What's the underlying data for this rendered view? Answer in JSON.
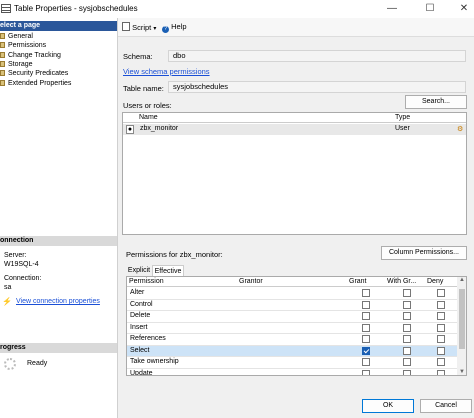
{
  "window": {
    "title": "Table Properties - sysjobschedules",
    "minimize": "—",
    "maximize": "☐",
    "close": "✕"
  },
  "left": {
    "select_page_header": "elect a page",
    "pages": [
      "General",
      "Permissions",
      "Change Tracking",
      "Storage",
      "Security Predicates",
      "Extended Properties"
    ],
    "connection_header": "onnection",
    "server_label": "Server:",
    "server_value": "W19SQL-4",
    "connection_label": "Connection:",
    "connection_value": "sa",
    "view_connection": "View connection properties",
    "progress_header": "rogress",
    "progress_status": "Ready"
  },
  "toolbar": {
    "script_label": "Script",
    "help_label": "Help"
  },
  "main": {
    "schema_label": "Schema:",
    "schema_value": "dbo",
    "view_schema_link": "View schema permissions",
    "table_name_label": "Table name:",
    "table_name_value": "sysjobschedules",
    "users_roles_label": "Users or roles:",
    "search_button": "Search...",
    "users_grid": {
      "headers": [
        "Name",
        "Type"
      ],
      "rows": [
        {
          "name": "zbx_monitor",
          "type": "User"
        }
      ]
    },
    "permissions_label": "Permissions for zbx_monitor:",
    "column_permissions_button": "Column Permissions...",
    "tabs": [
      "Explicit",
      "Effective"
    ],
    "perm_headers": [
      "Permission",
      "Grantor",
      "Grant",
      "With Gr...",
      "Deny"
    ],
    "permissions": [
      {
        "name": "Alter",
        "grant": false,
        "with_grant": false,
        "deny": false,
        "selected": false
      },
      {
        "name": "Control",
        "grant": false,
        "with_grant": false,
        "deny": false,
        "selected": false
      },
      {
        "name": "Delete",
        "grant": false,
        "with_grant": false,
        "deny": false,
        "selected": false
      },
      {
        "name": "Insert",
        "grant": false,
        "with_grant": false,
        "deny": false,
        "selected": false
      },
      {
        "name": "References",
        "grant": false,
        "with_grant": false,
        "deny": false,
        "selected": false
      },
      {
        "name": "Select",
        "grant": true,
        "with_grant": false,
        "deny": false,
        "selected": true
      },
      {
        "name": "Take ownership",
        "grant": false,
        "with_grant": false,
        "deny": false,
        "selected": false
      },
      {
        "name": "Update",
        "grant": false,
        "with_grant": false,
        "deny": false,
        "selected": false
      }
    ]
  },
  "footer": {
    "ok_button": "OK",
    "cancel_button": "Cancel"
  }
}
